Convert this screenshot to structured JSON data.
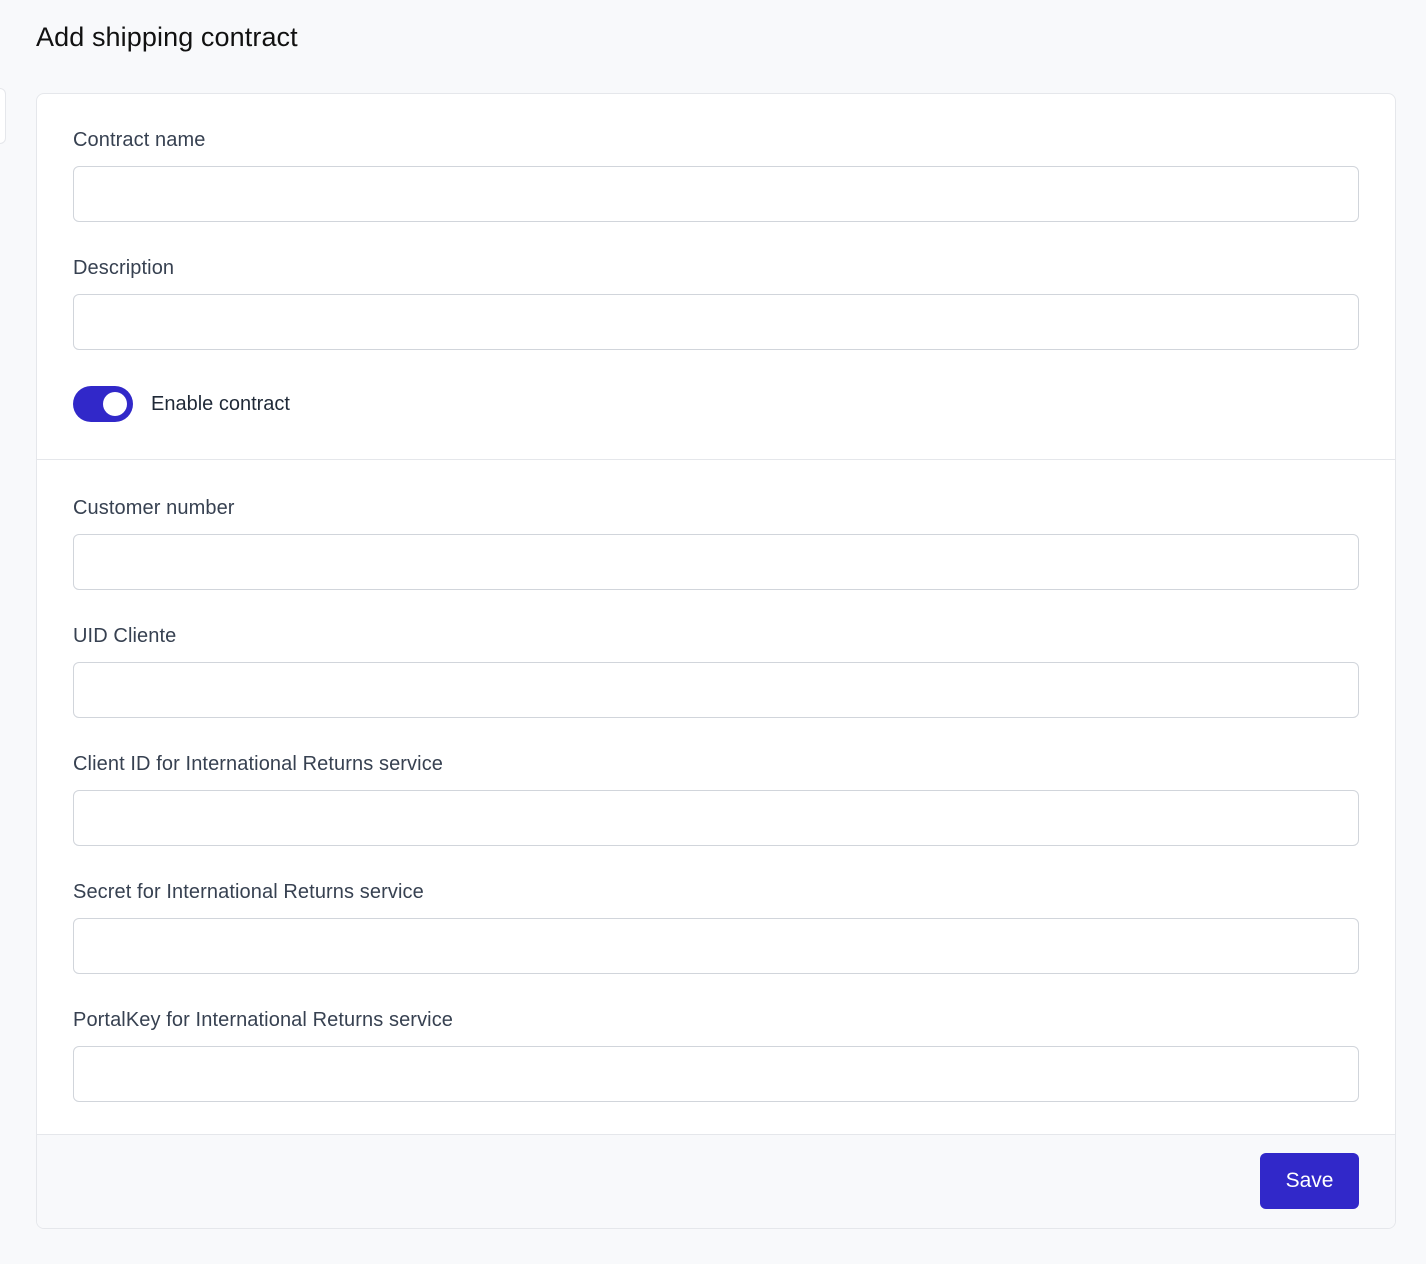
{
  "page": {
    "title": "Add shipping contract"
  },
  "form": {
    "general": {
      "contract_name": {
        "label": "Contract name",
        "value": "",
        "placeholder": ""
      },
      "description": {
        "label": "Description",
        "value": "",
        "placeholder": ""
      },
      "enable_contract": {
        "label": "Enable contract",
        "checked": true
      }
    },
    "credentials": {
      "customer_number": {
        "label": "Customer number",
        "value": "",
        "placeholder": ""
      },
      "uid_cliente": {
        "label": "UID Cliente",
        "value": "",
        "placeholder": ""
      },
      "client_id": {
        "label": "Client ID for International Returns service",
        "value": "",
        "placeholder": ""
      },
      "secret": {
        "label": "Secret for International Returns service",
        "value": "",
        "placeholder": ""
      },
      "portal_key": {
        "label": "PortalKey for International Returns service",
        "value": "",
        "placeholder": ""
      }
    }
  },
  "footer": {
    "save_label": "Save"
  },
  "colors": {
    "accent": "#3128c9",
    "background": "#f8f9fb",
    "border": "#e5e7eb"
  }
}
